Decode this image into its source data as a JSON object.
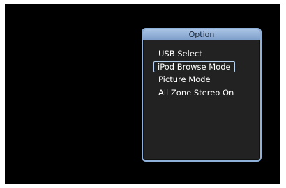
{
  "option_menu": {
    "title": "Option",
    "items": [
      {
        "label": "USB Select",
        "selected": false
      },
      {
        "label": "iPod Browse Mode",
        "selected": true
      },
      {
        "label": "Picture Mode",
        "selected": false
      },
      {
        "label": "All Zone Stereo On",
        "selected": false
      }
    ]
  },
  "colors": {
    "screen_background": "#000000",
    "panel_border": "#8fb0d8",
    "highlight": "#b9d2ef",
    "text": "#ffffff"
  }
}
